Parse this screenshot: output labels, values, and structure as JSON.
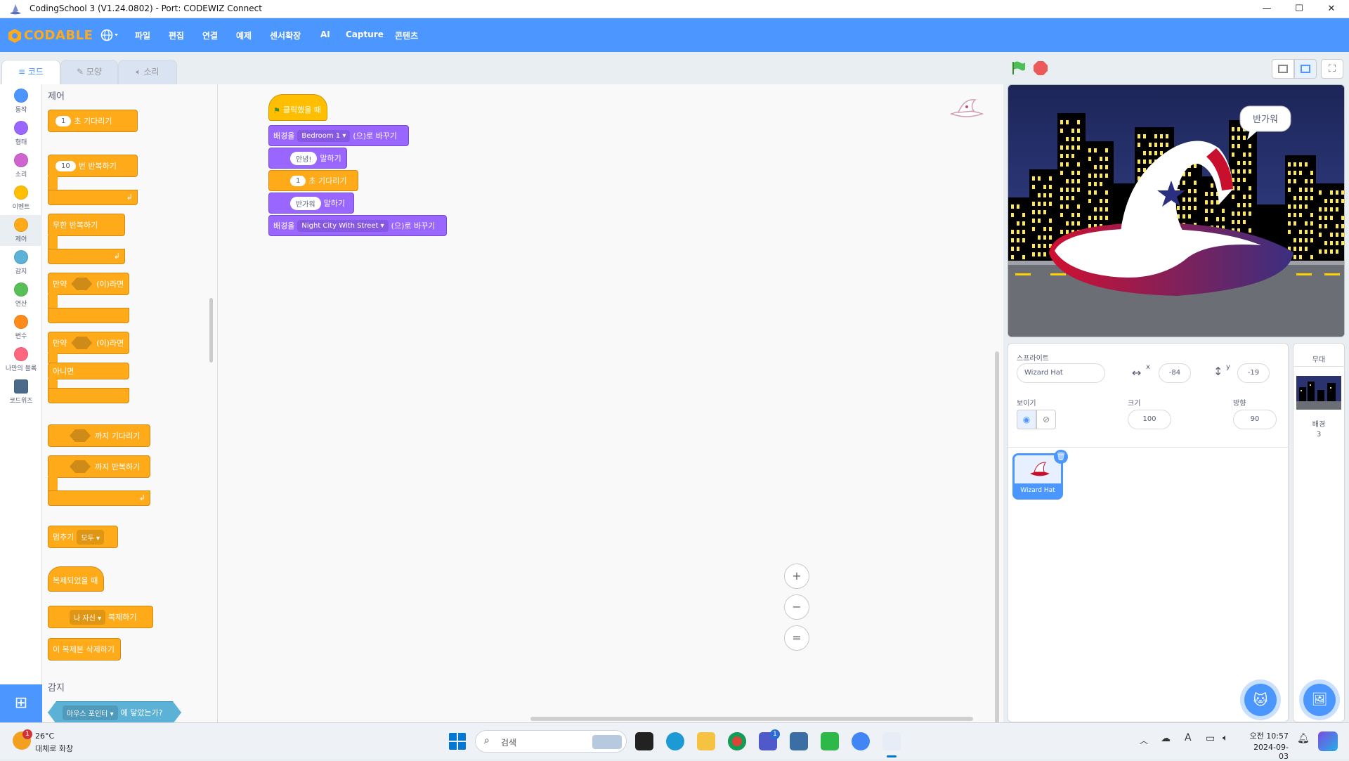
{
  "window": {
    "title": "CodingSchool 3 (V1.24.0802) - Port: CODEWIZ Connect",
    "minimize": "—",
    "maximize": "☐",
    "close": "✕"
  },
  "menubar": {
    "logo": "CODABLE",
    "language_icon": "globe-icon",
    "items": [
      "파일",
      "편집",
      "연결",
      "예제",
      "센서확장",
      "AI",
      "Capture",
      "콘텐츠"
    ]
  },
  "tabs": {
    "code": "코드",
    "costume": "모양",
    "sound": "소리"
  },
  "categories": [
    {
      "label": "동작",
      "color": "#4c97ff"
    },
    {
      "label": "형태",
      "color": "#9966ff"
    },
    {
      "label": "소리",
      "color": "#cf63cf"
    },
    {
      "label": "이벤트",
      "color": "#ffbf00"
    },
    {
      "label": "제어",
      "color": "#ffab19"
    },
    {
      "label": "감지",
      "color": "#5cb1d6"
    },
    {
      "label": "연산",
      "color": "#59c059"
    },
    {
      "label": "변수",
      "color": "#ff8c1a"
    },
    {
      "label": "나만의 블록",
      "color": "#ff6680"
    },
    {
      "label": "코드위즈",
      "color": "#4a6a8a"
    }
  ],
  "palette": {
    "section_control": "제어",
    "wait_value": "1",
    "wait_label": "초 기다리기",
    "repeat_value": "10",
    "repeat_label": "번 반복하기",
    "forever_label": "무한 반복하기",
    "if_label": "만약",
    "if_then_label": "(이)라면",
    "else_label": "아니면",
    "wait_until_label": "까지 기다리기",
    "repeat_until_label": "까지 반복하기",
    "stop_label": "멈추기",
    "stop_option": "모두",
    "clone_start_label": "복제되었을 때",
    "clone_target": "나 자신",
    "clone_label": "복제하기",
    "delete_clone_label": "이 복제본 삭제하기",
    "section_sensing": "감지",
    "touching_target": "마우스 포인터",
    "touching_label": "에 닿았는가?"
  },
  "script": {
    "flag_label": "클릭했을 때",
    "switch_bg_prefix": "배경을",
    "bg1": "Bedroom 1",
    "switch_bg_suffix": "(으)로 바꾸기",
    "say1": "안녕!",
    "say_label": "말하기",
    "wait_value": "1",
    "wait_label": "초 기다리기",
    "say2": "반가워",
    "bg2": "Night City With Street"
  },
  "zoom": {
    "in": "+",
    "out": "−",
    "reset": "="
  },
  "stage": {
    "speech": "반가워"
  },
  "sprite_info": {
    "sprite_label": "스프라이트",
    "sprite_name": "Wizard Hat",
    "x_label": "x",
    "x_value": "-84",
    "y_label": "y",
    "y_value": "-19",
    "show_label": "보이기",
    "size_label": "크기",
    "size_value": "100",
    "direction_label": "방향",
    "direction_value": "90"
  },
  "sprite_tile": {
    "name": "Wizard Hat"
  },
  "stage_panel": {
    "title": "무대",
    "backdrops_label": "배경",
    "backdrops_count": "3"
  },
  "taskbar": {
    "weather_temp": "26°C",
    "weather_desc": "대체로 화창",
    "weather_badge": "1",
    "search_placeholder": "검색",
    "teams_badge": "1",
    "time": "오전 10:57",
    "date": "2024-09-03"
  }
}
